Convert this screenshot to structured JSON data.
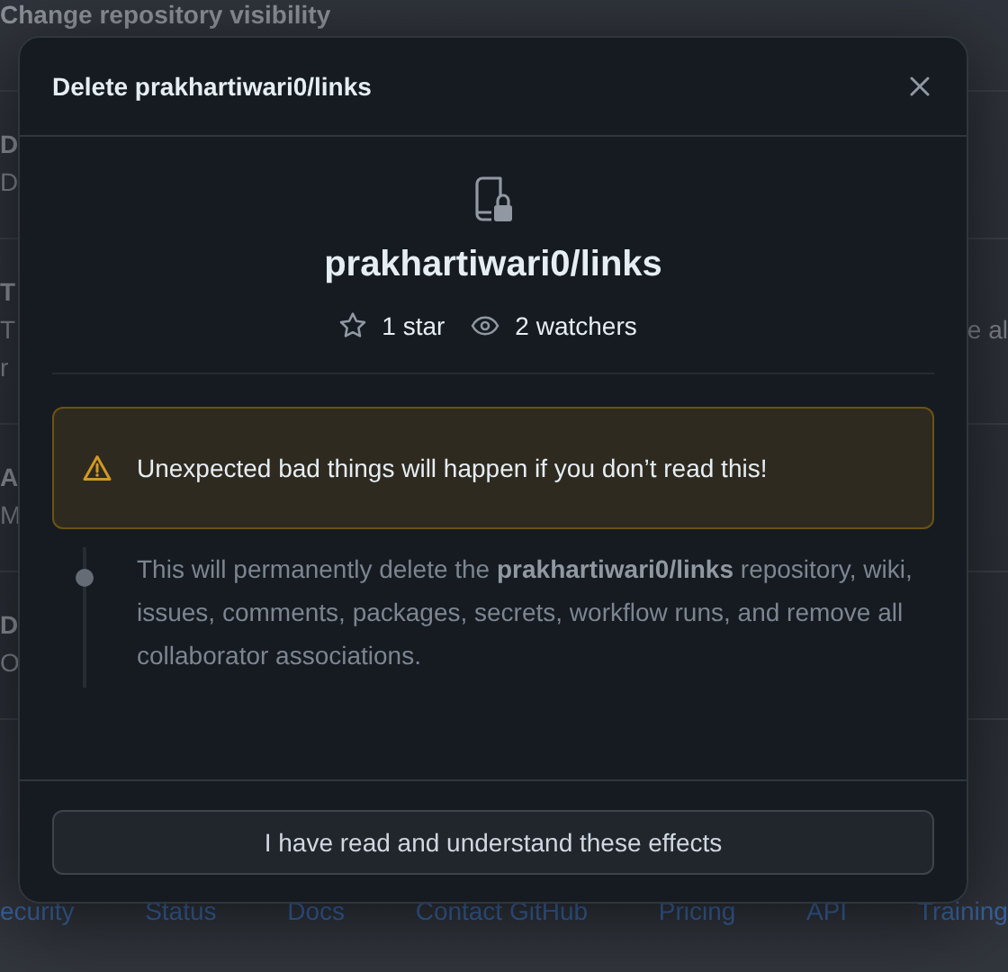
{
  "background": {
    "sections": [
      {
        "title": "Change repository visibility"
      },
      {
        "title": "D",
        "lines": [
          "D"
        ]
      },
      {
        "title": "T",
        "lines": [
          "T",
          "r"
        ],
        "right_text": "e al"
      },
      {
        "title": "A",
        "lines": [
          "M"
        ]
      },
      {
        "title": "D",
        "lines": [
          "O"
        ]
      }
    ],
    "footer_links": [
      "ecurity",
      "Status",
      "Docs",
      "Contact GitHub",
      "Pricing",
      "API",
      "Training"
    ]
  },
  "dialog": {
    "title": "Delete prakhartiwari0/links",
    "repo_name": "prakhartiwari0/links",
    "stats": [
      {
        "kind": "star",
        "text": "1 star"
      },
      {
        "kind": "watchers",
        "text": "2 watchers"
      }
    ],
    "warning": "Unexpected bad things will happen if you don’t read this!",
    "effects": [
      "This will permanently delete the **prakhartiwari0/links** repository, wiki, issues, comments, packages, secrets, workflow runs, and remove all collaborator associations."
    ],
    "button": "I have read and understand these effects"
  }
}
